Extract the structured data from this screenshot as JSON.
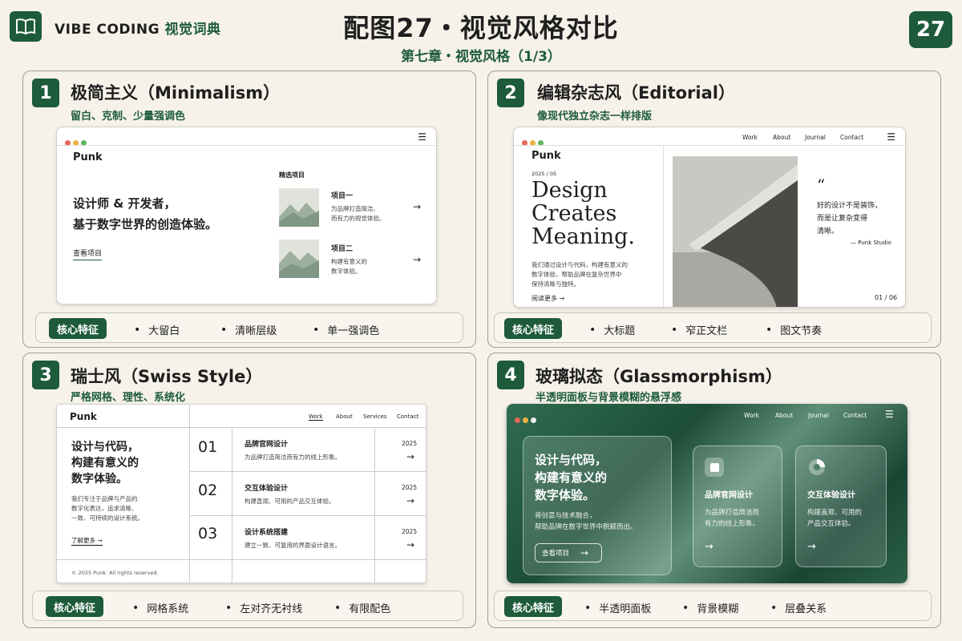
{
  "header": {
    "brand_en": "VIBE CODING",
    "brand_cn": "视觉词典",
    "title": "配图27・视觉风格对比",
    "subtitle": "第七章・视觉风格（1/3）",
    "page_number": "27"
  },
  "feature_label": "核心特征",
  "panels": [
    {
      "num": "1",
      "title": "极简主义（Minimalism）",
      "subtitle": "留白、克制、少量强调色",
      "features": [
        "大留白",
        "清晰层级",
        "单一强调色"
      ],
      "mock": {
        "brand": "Punk",
        "headline1": "设计师 & 开发者，",
        "headline2": "基于数字世界的创造体验。",
        "link": "查看项目",
        "section": "精选项目",
        "items": [
          {
            "title": "项目一",
            "desc1": "为品牌打造简洁、",
            "desc2": "而有力的视觉体验。"
          },
          {
            "title": "项目二",
            "desc1": "构建有意义的",
            "desc2": "数字体验。"
          }
        ]
      }
    },
    {
      "num": "2",
      "title": "编辑杂志风（Editorial）",
      "subtitle": "像现代独立杂志一样排版",
      "features": [
        "大标题",
        "窄正文栏",
        "图文节奏"
      ],
      "mock": {
        "brand": "Punk",
        "nav": [
          "Work",
          "About",
          "Journal",
          "Contact"
        ],
        "date": "2025 / 05",
        "h1": "Design",
        "h2": "Creates",
        "h3": "Meaning.",
        "body1": "我们通过设计与代码，构建有意义的",
        "body2": "数字体验，帮助品牌在复杂世界中",
        "body3": "保持清晰与独特。",
        "link": "阅读更多",
        "quote1": "好的设计不是装饰，",
        "quote2": "而是让复杂变得",
        "quote3": "清晰。",
        "quote_by": "— Punk Studio",
        "pager": "01 / 06"
      }
    },
    {
      "num": "3",
      "title": "瑞士风（Swiss Style）",
      "subtitle": "严格网格、理性、系统化",
      "features": [
        "网格系统",
        "左对齐无衬线",
        "有限配色"
      ],
      "mock": {
        "brand": "Punk",
        "nav": [
          "Work",
          "About",
          "Services",
          "Contact"
        ],
        "h1": "设计与代码，",
        "h2": "构建有意义的",
        "h3": "数字体验。",
        "body1": "我们专注于品牌与产品的",
        "body2": "数字化表达，追求清晰、",
        "body3": "一致、可持续的设计系统。",
        "link": "了解更多 →",
        "footer": "© 2025 Punk. All rights reserved.",
        "rows": [
          {
            "n": "01",
            "t": "品牌官网设计",
            "d": "为品牌打造简洁而有力的线上形象。",
            "y": "2025"
          },
          {
            "n": "02",
            "t": "交互体验设计",
            "d": "构建直观、可用的产品交互体验。",
            "y": "2025"
          },
          {
            "n": "03",
            "t": "设计系统搭建",
            "d": "建立一致、可复用的界面设计语言。",
            "y": "2025"
          }
        ]
      }
    },
    {
      "num": "4",
      "title": "玻璃拟态（Glassmorphism）",
      "subtitle": "半透明面板与背景模糊的悬浮感",
      "features": [
        "半透明面板",
        "背景模糊",
        "层叠关系"
      ],
      "mock": {
        "nav": [
          "Work",
          "About",
          "Journal",
          "Contact"
        ],
        "h1": "设计与代码，",
        "h2": "构建有意义的",
        "h3": "数字体验。",
        "body1": "将创意与技术融合，",
        "body2": "帮助品牌在数字世界中脱颖而出。",
        "button": "查看项目",
        "cards": [
          {
            "title": "品牌官网设计",
            "d1": "为品牌打造简洁而",
            "d2": "有力的线上形象。"
          },
          {
            "title": "交互体验设计",
            "d1": "构建直观、可用的",
            "d2": "产品交互体验。"
          }
        ]
      }
    }
  ]
}
